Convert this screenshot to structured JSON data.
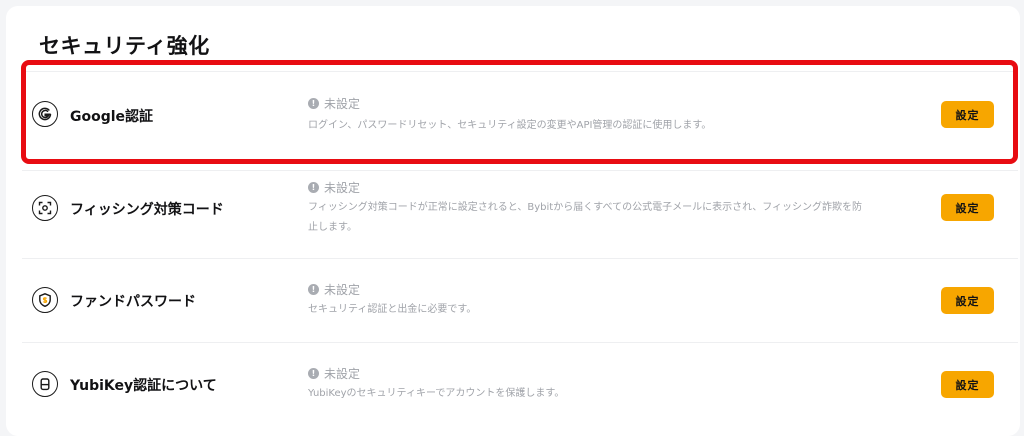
{
  "section": {
    "title": "セキュリティ強化"
  },
  "rows": [
    {
      "name": "Google認証",
      "status": "未設定",
      "description": "ログイン、パスワードリセット、セキュリティ設定の変更やAPI管理の認証に使用します。",
      "button": "設定",
      "icon": "google-icon"
    },
    {
      "name": "フィッシング対策コード",
      "status": "未設定",
      "description": "フィッシング対策コードが正常に設定されると、Bybitから届くすべての公式電子メールに表示され、フィッシング詐欺を防止します。",
      "button": "設定",
      "icon": "scan-code-icon"
    },
    {
      "name": "ファンドパスワード",
      "status": "未設定",
      "description": "セキュリティ認証と出金に必要です。",
      "button": "設定",
      "icon": "shield-dollar-icon"
    },
    {
      "name": "YubiKey認証について",
      "status": "未設定",
      "description": "YubiKeyのセキュリティキーでアカウントを保護します。",
      "button": "設定",
      "icon": "yubikey-icon"
    }
  ],
  "status_icon": "exclamation-icon",
  "colors": {
    "accent": "#f7a600",
    "highlight": "#e80c12",
    "muted_text": "#a0a3a9"
  }
}
